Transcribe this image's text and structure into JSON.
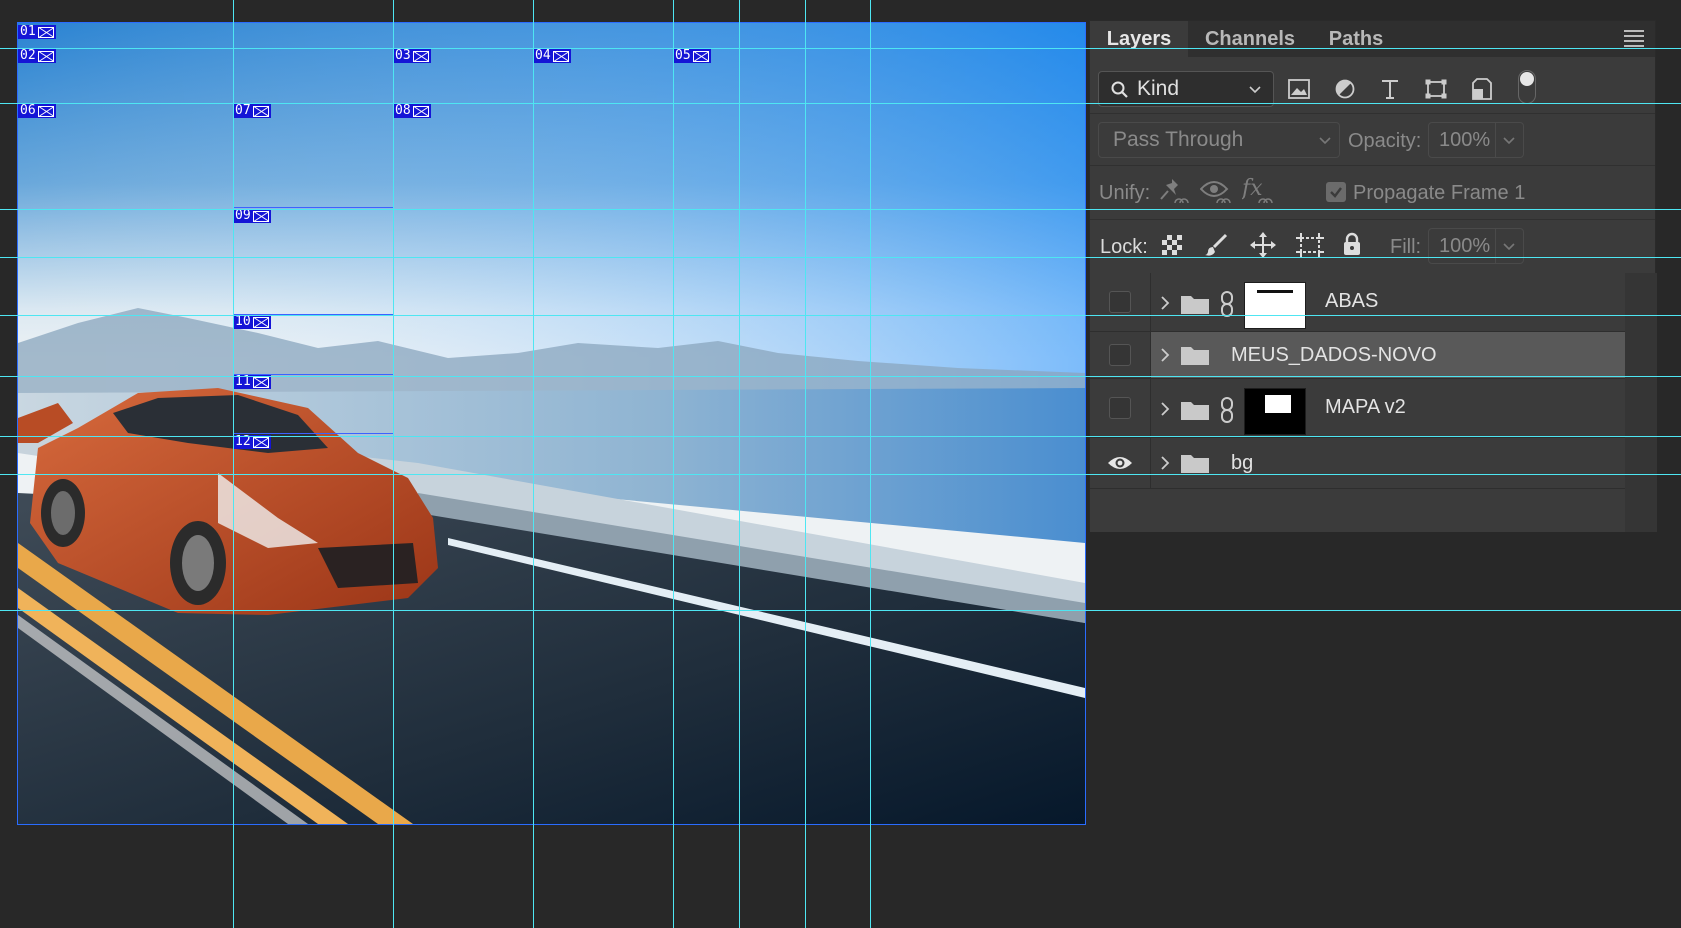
{
  "canvas": {
    "slice_labels": [
      "01",
      "02",
      "03",
      "04",
      "05",
      "06",
      "07",
      "08",
      "09",
      "10",
      "11",
      "12"
    ]
  },
  "panel": {
    "tabs": [
      "Layers",
      "Channels",
      "Paths"
    ],
    "filter": {
      "kind_label": "Kind"
    },
    "blend_mode": "Pass Through",
    "opacity_label": "Opacity:",
    "opacity_value": "100%",
    "unify_label": "Unify:",
    "propagate_label": "Propagate Frame 1",
    "lock_label": "Lock:",
    "fill_label": "Fill:",
    "fill_value": "100%",
    "layers": [
      {
        "name": "ABAS",
        "visible": false,
        "has_mask": true,
        "selected": false
      },
      {
        "name": "MEUS_DADOS-NOVO",
        "visible": false,
        "has_mask": false,
        "selected": true
      },
      {
        "name": "MAPA v2",
        "visible": false,
        "has_mask": true,
        "selected": false
      },
      {
        "name": "bg",
        "visible": true,
        "has_mask": false,
        "selected": false
      }
    ]
  },
  "colors": {
    "guide": "#4ee6f2",
    "slice": "#1515d6",
    "panel_bg": "#3b3b3b",
    "app_bg": "#282828"
  }
}
